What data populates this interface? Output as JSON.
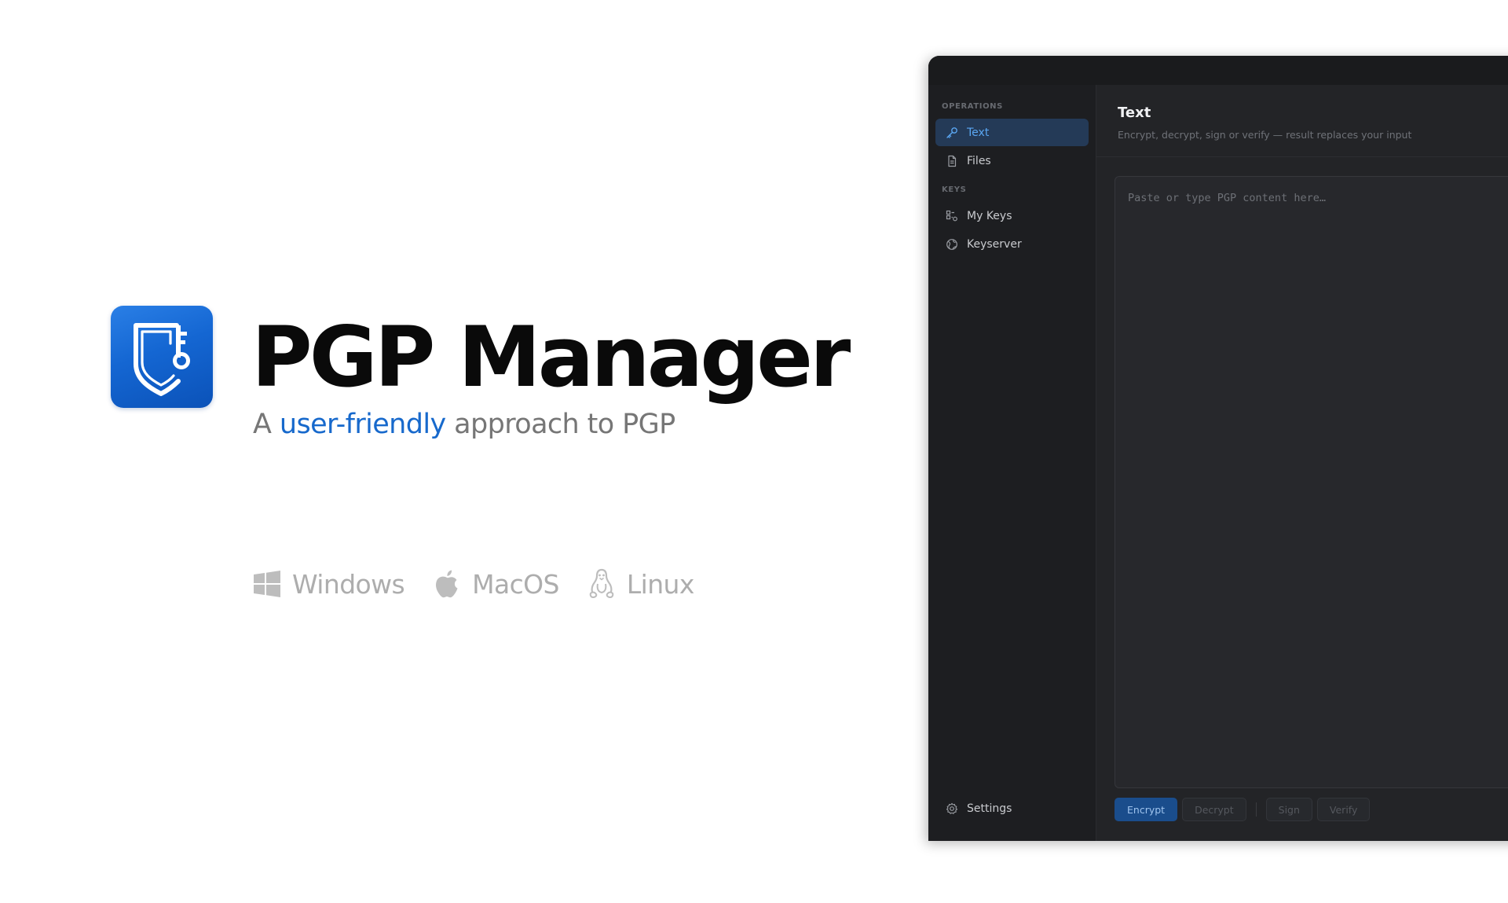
{
  "hero": {
    "title": "PGP Manager",
    "tagline": {
      "prefix": "A ",
      "highlight": "user-friendly",
      "suffix": " approach to PGP"
    },
    "platforms": [
      {
        "icon": "windows-icon",
        "label": "Windows"
      },
      {
        "icon": "apple-icon",
        "label": "MacOS"
      },
      {
        "icon": "linux-icon",
        "label": "Linux"
      }
    ],
    "colors": {
      "accent": "#1769cc",
      "icon_background": "#1466d2"
    }
  },
  "window": {
    "sidebar": {
      "sections": [
        {
          "label": "OPERATIONS",
          "items": [
            {
              "icon": "key-icon",
              "label": "Text",
              "active": true
            },
            {
              "icon": "file-icon",
              "label": "Files",
              "active": false
            }
          ]
        },
        {
          "label": "KEYS",
          "items": [
            {
              "icon": "keys-icon",
              "label": "My Keys",
              "active": false
            },
            {
              "icon": "globe-icon",
              "label": "Keyserver",
              "active": false
            }
          ]
        }
      ],
      "footer": {
        "icon": "gear-icon",
        "label": "Settings"
      }
    },
    "main": {
      "title": "Text",
      "subtitle": "Encrypt, decrypt, sign or verify — result replaces your input",
      "editor": {
        "value": "",
        "placeholder": "Paste or type PGP content here…"
      },
      "actions": {
        "encrypt": "Encrypt",
        "decrypt": "Decrypt",
        "sign": "Sign",
        "verify": "Verify"
      }
    },
    "colors": {
      "background": "#232427",
      "sidebar": "#1d1e21",
      "active_item": "#243a57",
      "active_text": "#5aa6f2",
      "primary_button": "#1a4d8c"
    }
  }
}
